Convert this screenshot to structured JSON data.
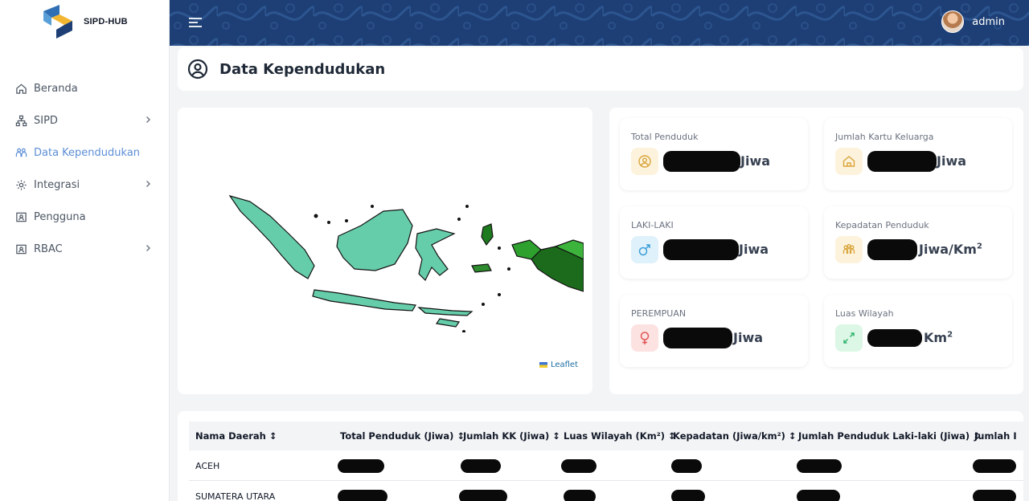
{
  "brand": {
    "name": "SIPD-HUB"
  },
  "sidebar": {
    "items": [
      {
        "label": "Beranda",
        "icon": "home-icon",
        "has_children": false
      },
      {
        "label": "SIPD",
        "icon": "sitemap-icon",
        "has_children": true
      },
      {
        "label": "Data Kependudukan",
        "icon": "people-icon",
        "has_children": false,
        "active": true
      },
      {
        "label": "Integrasi",
        "icon": "gear-icon",
        "has_children": true
      },
      {
        "label": "Pengguna",
        "icon": "user-card-icon",
        "has_children": false
      },
      {
        "label": "RBAC",
        "icon": "user-card-icon",
        "has_children": true
      }
    ]
  },
  "topbar": {
    "user_name": "admin"
  },
  "page": {
    "title": "Data Kependudukan"
  },
  "map": {
    "attribution": "Leaflet"
  },
  "stats": {
    "total_penduduk": {
      "label": "Total Penduduk",
      "unit": "Jiwa"
    },
    "jumlah_kk": {
      "label": "Jumlah Kartu Keluarga",
      "unit": "Jiwa"
    },
    "laki_laki": {
      "label": "LAKI-LAKI",
      "unit": "Jiwa"
    },
    "kepadatan": {
      "label": "Kepadatan Penduduk",
      "unit": "Jiwa/Km",
      "unit_sup": "2"
    },
    "perempuan": {
      "label": "PEREMPUAN",
      "unit": "Jiwa"
    },
    "luas_wilayah": {
      "label": "Luas Wilayah",
      "unit": "Km",
      "unit_sup": "2"
    }
  },
  "table": {
    "headers": [
      "Nama Daerah ↕",
      "Total Penduduk (Jiwa) ↕",
      "Jumlah KK (Jiwa) ↕",
      "Luas Wilayah (Km²) ↕",
      "Kepadatan (Jiwa/km²) ↕",
      "Jumlah Penduduk Laki-laki (Jiwa) ↕",
      "Jumlah I"
    ],
    "rows": [
      {
        "name": "ACEH"
      },
      {
        "name": "SUMATERA UTARA"
      }
    ]
  },
  "colors": {
    "accent": "#5b8ed6",
    "topbar": "#1d3f75",
    "map_light": "#66cdaa",
    "map_dark_green": "#1e7a1e"
  }
}
